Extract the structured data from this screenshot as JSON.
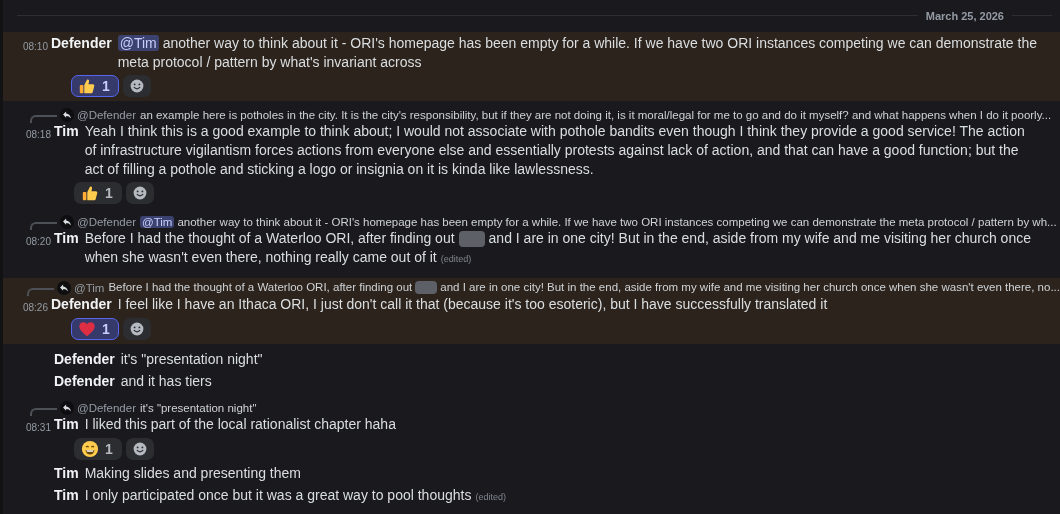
{
  "date_divider": "March 25, 2026",
  "messages": [
    {
      "highlighted": true,
      "time": "08:10",
      "author": "Defender",
      "content": [
        {
          "kind": "mention",
          "text": "@Tim"
        },
        {
          "kind": "text",
          "text": "another way to think about it - ORI's homepage has been empty for a while. If we have two ORI instances competing we can demonstrate the meta protocol / pattern by what's invariant across"
        }
      ],
      "reactions": [
        {
          "kind": "thumbs_up",
          "count": "1",
          "selected": true
        }
      ]
    },
    {
      "highlighted": false,
      "reply": {
        "author": "@Defender",
        "content": [
          {
            "kind": "text",
            "text": "an example here is potholes in the city. It is the city's responsibility, but if they are not doing it, is it moral/legal for me to go and do it myself?  and what happens when I do it poorly..."
          }
        ]
      },
      "time": "08:18",
      "author": "Tim",
      "content": [
        {
          "kind": "text",
          "text": "Yeah I think this is a good example to think about; I would not associate with pothole bandits even though I think they provide a good service! The action of infrastructure vigilantism forces actions from everyone else and essentially protests against lack of action, and that can have a good function; but the act of filling a pothole and sticking a logo or insignia on it is kinda like lawlessness."
        }
      ],
      "reactions": [
        {
          "kind": "thumbs_up",
          "count": "1",
          "selected": false
        }
      ]
    },
    {
      "highlighted": false,
      "reply": {
        "author": "@Defender",
        "content": [
          {
            "kind": "mention",
            "text": "@Tim"
          },
          {
            "kind": "text",
            "text": "another way to think about it - ORI's homepage has been empty for a while. If we have two ORI instances competing we can demonstrate the meta protocol / pattern by wh..."
          }
        ]
      },
      "time": "08:20",
      "author": "Tim",
      "content": [
        {
          "kind": "text",
          "text": "Before I had the thought of a Waterloo ORI, after finding out"
        },
        {
          "kind": "redacted"
        },
        {
          "kind": "text",
          "text": "and I are in one city! But in the end, aside from my wife and me visiting her church once when she wasn't even there, nothing really came out of it"
        }
      ],
      "edited_label": "(edited)"
    },
    {
      "highlighted": true,
      "reply": {
        "author": "@Tim",
        "content": [
          {
            "kind": "text",
            "text": "Before I had the thought of a Waterloo ORI, after finding out"
          },
          {
            "kind": "redacted"
          },
          {
            "kind": "text",
            "text": "and I are in one city! But in the end, aside from my wife and me visiting her church once when she wasn't even there, no..."
          }
        ]
      },
      "time": "08:26",
      "author": "Defender",
      "content": [
        {
          "kind": "text",
          "text": "I feel like I have an Ithaca ORI, I just don't call it that (because it's too esoteric), but I have successfully translated it"
        }
      ],
      "reactions": [
        {
          "kind": "heart",
          "count": "1",
          "selected": true
        }
      ]
    },
    {
      "highlighted": false,
      "author": "Defender",
      "content": [
        {
          "kind": "text",
          "text": "it's \"presentation night\""
        }
      ]
    },
    {
      "highlighted": false,
      "author": "Defender",
      "content": [
        {
          "kind": "text",
          "text": "and it has tiers"
        }
      ]
    },
    {
      "highlighted": false,
      "reply": {
        "author": "@Defender",
        "content": [
          {
            "kind": "text",
            "text": "it's \"presentation night\""
          }
        ]
      },
      "time": "08:31",
      "author": "Tim",
      "content": [
        {
          "kind": "text",
          "text": "I liked this part of the local rationalist chapter haha"
        }
      ],
      "reactions": [
        {
          "kind": "grin",
          "count": "1",
          "selected": false
        }
      ]
    },
    {
      "highlighted": false,
      "author": "Tim",
      "content": [
        {
          "kind": "text",
          "text": "Making slides and presenting them"
        }
      ]
    },
    {
      "highlighted": false,
      "author": "Tim",
      "content": [
        {
          "kind": "text",
          "text": "I only participated once but it was a great way to pool thoughts"
        }
      ],
      "edited_label": "(edited)"
    }
  ]
}
